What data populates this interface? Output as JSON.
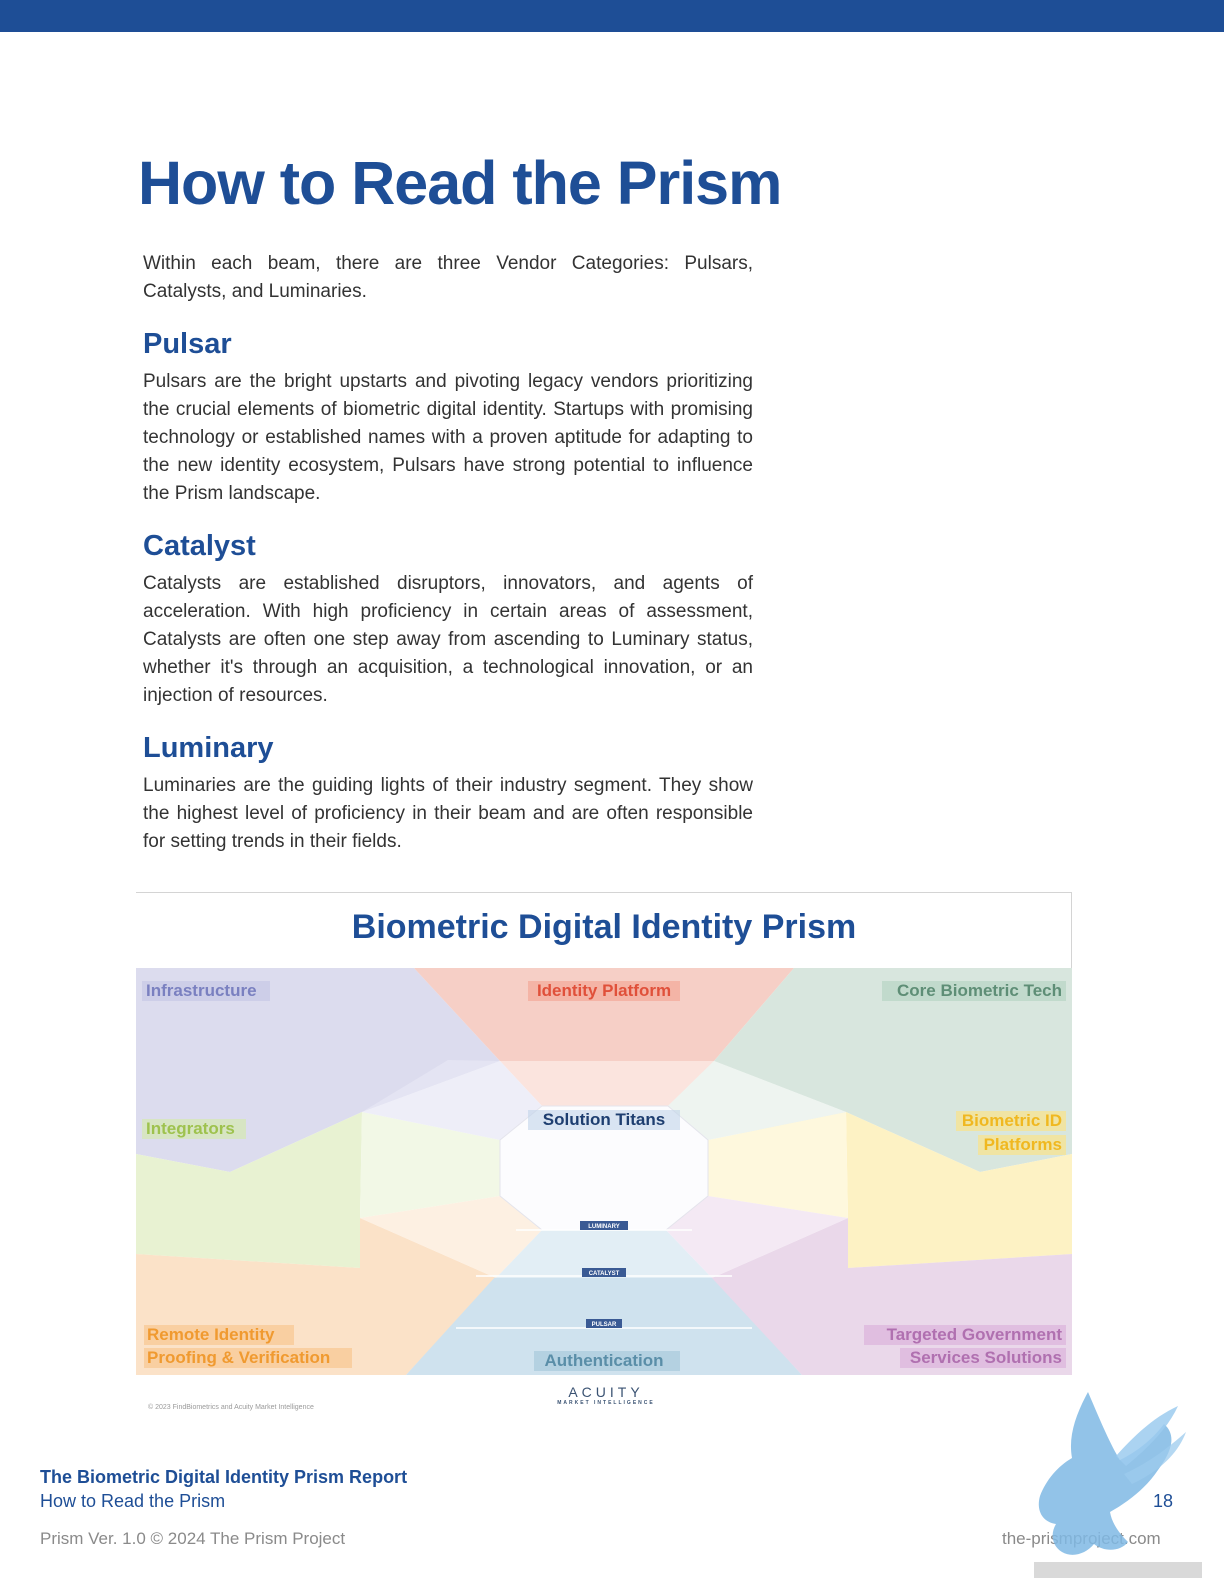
{
  "page": {
    "title": "How to Read the Prism",
    "intro": "Within each beam, there are three Vendor Categories: Pulsars, Catalysts, and Luminaries."
  },
  "sections": [
    {
      "title": "Pulsar",
      "body": "Pulsars are the bright upstarts and pivoting legacy vendors prioritizing the crucial elements of biometric digital identity. Startups with promising technology or established names with a proven aptitude for adapting to the new identity ecosystem, Pulsars have strong potential to influence the Prism landscape."
    },
    {
      "title": "Catalyst",
      "body": "Catalysts are established disruptors, innovators, and agents of acceleration. With high proficiency in certain areas of assessment, Catalysts are often one step away from ascending to Luminary status, whether it's through an acquisition, a technological innovation, or an injection of resources."
    },
    {
      "title": "Luminary",
      "body": "Luminaries are the guiding lights of their industry segment. They show the highest level of proficiency in their beam and are often responsible for setting trends in their fields."
    }
  ],
  "figure": {
    "title": "Biometric Digital Identity Prism",
    "center_label": "Solution Titans",
    "tiers": [
      "LUMINARY",
      "CATALYST",
      "PULSAR"
    ],
    "beams": {
      "infrastructure": "Infrastructure",
      "identity_platform": "Identity Platform",
      "core_biometric_tech": "Core Biometric Tech",
      "integrators": "Integrators",
      "biometric_id_platforms_line1": "Biometric ID",
      "biometric_id_platforms_line2": "Platforms",
      "remote_identity_line1": "Remote Identity",
      "remote_identity_line2": "Proofing & Verification",
      "authentication": "Authentication",
      "targeted_government_line1": "Targeted Government",
      "targeted_government_line2": "Services Solutions"
    },
    "copyright": "© 2023 FindBiometrics and Acuity Market Intelligence",
    "logo_name": "ACUITY",
    "logo_sub": "MARKET INTELLIGENCE"
  },
  "footer": {
    "report_title": "The Biometric Digital Identity Prism Report",
    "section_title": "How to Read the Prism",
    "version": "Prism Ver. 1.0 © 2024 The Prism Project",
    "page_number": "18",
    "url": "the-prismproject.com"
  },
  "colors": {
    "brand_blue": "#1e4e96",
    "infrastructure": "#dcdcee",
    "identity_platform": "#f6cfc6",
    "core_biometric_tech": "#d8e6de",
    "integrators": "#e8f2d2",
    "biometric_id_platforms": "#fdf2c4",
    "remote_identity": "#fbe2c8",
    "authentication": "#cfe2ee",
    "targeted_government": "#ead8ea"
  }
}
